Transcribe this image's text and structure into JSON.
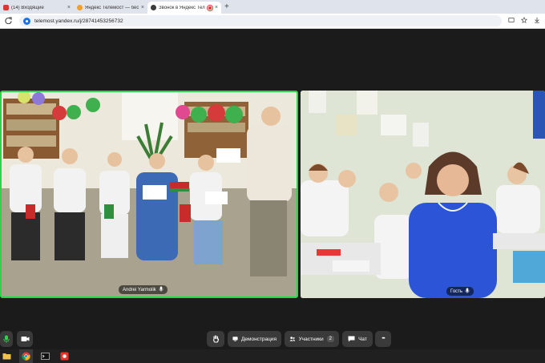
{
  "browser": {
    "tabs": [
      {
        "label": "(14) Входящие",
        "favicon_color": "#d33c2f"
      },
      {
        "label": "Яндекс Телемост — бесплатн…",
        "favicon_color": "#f0a02b"
      },
      {
        "label": "Звонок в Яндекс Телемост",
        "favicon_color": "#3b3b3b",
        "active": true
      }
    ],
    "close_glyph": "×",
    "new_tab_glyph": "+",
    "url": "telemost.yandex.ru/j/28741453256732"
  },
  "call": {
    "participants": [
      {
        "name": "Andrei Yarmolik",
        "mic_icon": "mic-icon"
      },
      {
        "name": "Гость",
        "mic_icon": "mic-icon"
      }
    ]
  },
  "controls": {
    "share_label": "Демонстрация",
    "participants_label": "Участники",
    "participants_count": "2",
    "chat_label": "Чат",
    "more_glyph": "•••"
  },
  "colors": {
    "active_speaker_border": "#2fd24a",
    "stage_bg": "#1b1b1b",
    "mic_active": "#2fd24a"
  }
}
